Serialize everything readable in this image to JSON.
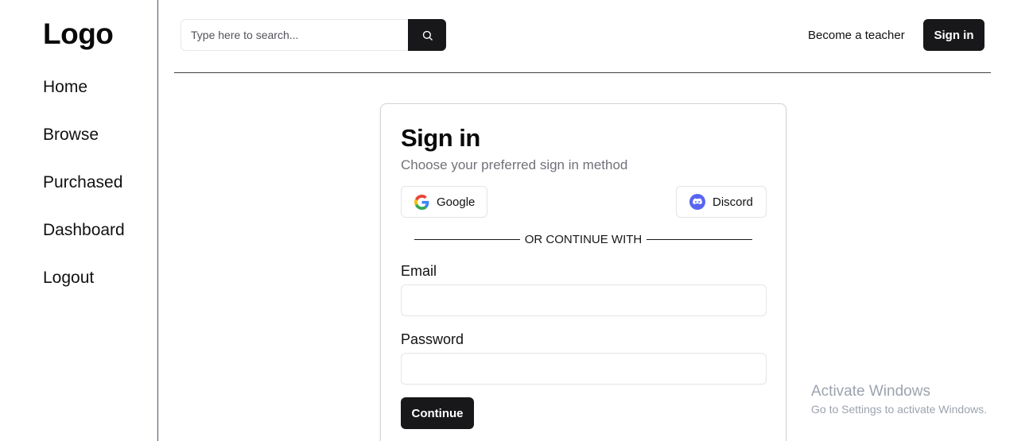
{
  "sidebar": {
    "logo": "Logo",
    "items": [
      {
        "label": "Home"
      },
      {
        "label": "Browse"
      },
      {
        "label": "Purchased"
      },
      {
        "label": "Dashboard"
      },
      {
        "label": "Logout"
      }
    ]
  },
  "header": {
    "search": {
      "placeholder": "Type here to search...",
      "value": "",
      "icon": "search-icon"
    },
    "teacher_link": "Become a teacher",
    "signin_label": "Sign in"
  },
  "signin_card": {
    "title": "Sign in",
    "subtitle": "Choose your preferred sign in method",
    "google_label": "Google",
    "discord_label": "Discord",
    "divider_text": "OR CONTINUE WITH",
    "email_label": "Email",
    "email_value": "",
    "password_label": "Password",
    "password_value": "",
    "continue_label": "Continue"
  },
  "watermark": {
    "title": "Activate Windows",
    "subtitle": "Go to Settings to activate Windows."
  },
  "colors": {
    "primary": "#18181b",
    "muted_text": "#71717a",
    "border": "#e4e4e7",
    "discord_brand": "#5865F2"
  }
}
